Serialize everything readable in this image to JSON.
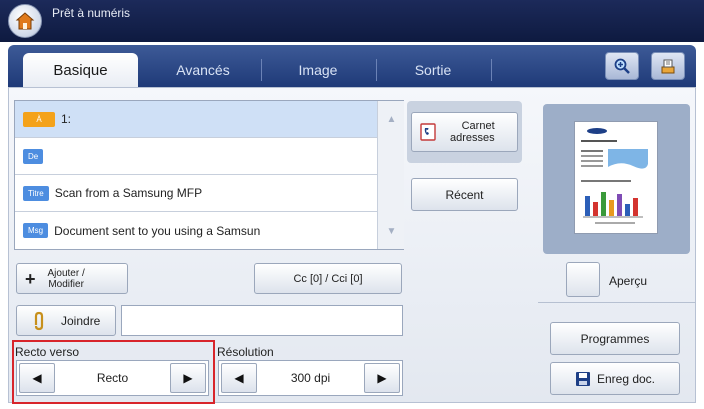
{
  "header": {
    "title": "Prêt à numéris"
  },
  "tabs": [
    {
      "label": "Basique",
      "active": true
    },
    {
      "label": "Avancés"
    },
    {
      "label": "Image"
    },
    {
      "label": "Sortie"
    }
  ],
  "toolbar": {
    "zoom_icon": "magnifier-plus-icon",
    "job_icon": "stack-icon"
  },
  "address_list": {
    "rows": [
      {
        "tag": "À",
        "text": "1:"
      },
      {
        "tag": "De",
        "text": ""
      },
      {
        "tag": "Titre",
        "text": "Scan from a Samsung MFP"
      },
      {
        "tag": "Msg",
        "text": "Document sent to you using a Samsun"
      }
    ]
  },
  "buttons": {
    "carnet": "Carnet\nadresses",
    "recent": "Récent",
    "add_modify": "Ajouter /\nModifier",
    "cc": "Cc [0] / Cci [0]",
    "attach": "Joindre",
    "preview": "Aperçu",
    "programs": "Programmes",
    "save_doc": "Enreg doc."
  },
  "duplex": {
    "label": "Recto verso",
    "value": "Recto"
  },
  "resolution": {
    "label": "Résolution",
    "value": "300 dpi"
  },
  "colors": {
    "header": "#1c2a5a",
    "tabbar": "#2a4888",
    "highlight": "#d8252b",
    "tag_to": "#f4a21a",
    "tag_other": "#4d8de0"
  }
}
